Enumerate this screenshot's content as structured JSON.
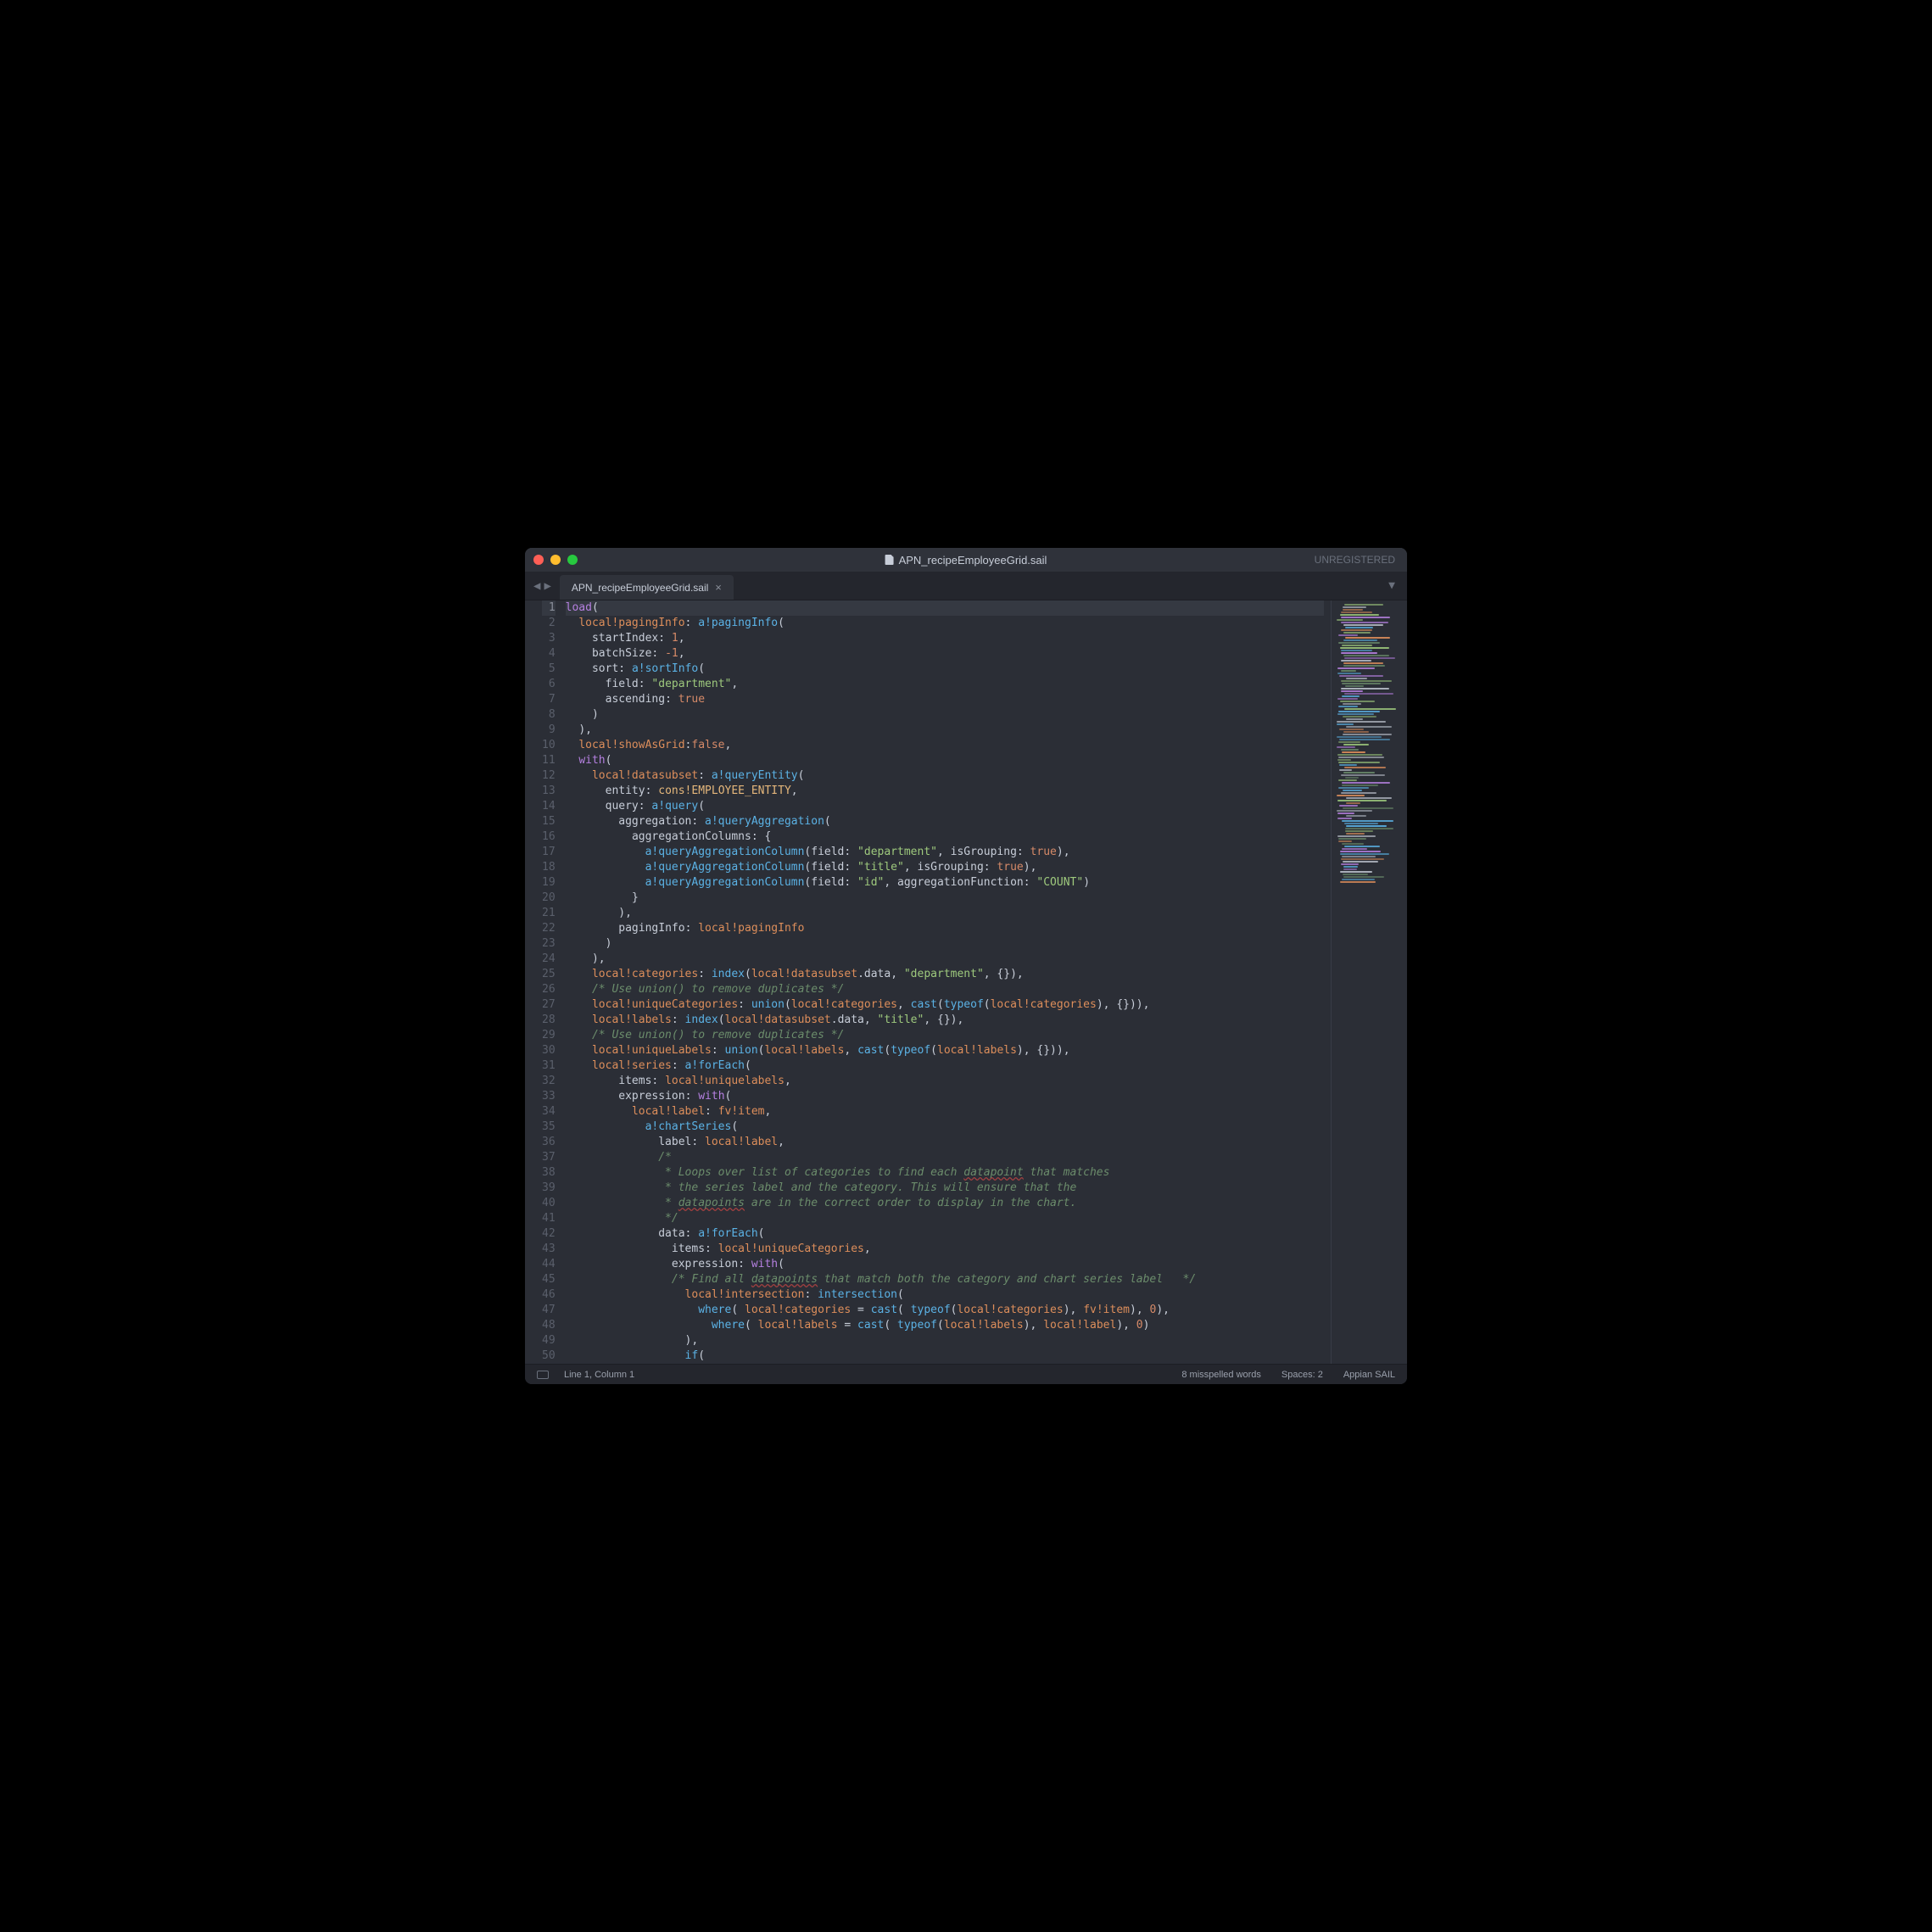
{
  "window": {
    "title": "APN_recipeEmployeeGrid.sail",
    "unregistered": "UNREGISTERED"
  },
  "tab": {
    "label": "APN_recipeEmployeeGrid.sail",
    "close": "×"
  },
  "statusbar": {
    "position": "Line 1, Column 1",
    "spell": "8 misspelled words",
    "spaces": "Spaces: 2",
    "syntax": "Appian SAIL"
  },
  "arrows": {
    "left": "◀",
    "right": "▶",
    "menu": "▼"
  },
  "lines": [
    1,
    2,
    3,
    4,
    5,
    6,
    7,
    8,
    9,
    10,
    11,
    12,
    13,
    14,
    15,
    16,
    17,
    18,
    19,
    20,
    21,
    22,
    23,
    24,
    25,
    26,
    27,
    28,
    29,
    30,
    31,
    32,
    33,
    34,
    35,
    36,
    37,
    38,
    39,
    40,
    41,
    42,
    43,
    44,
    45,
    46,
    47,
    48,
    49,
    50
  ],
  "code": {
    "indent": "  ",
    "kw_load": "load",
    "kw_with": "with",
    "lparen": "(",
    "rparen": ")",
    "lbrace": "{",
    "rbrace": "}",
    "comma": ",",
    "colon": ":",
    "dot": ".",
    "eq": "=",
    "local_pagingInfo": "local!pagingInfo",
    "local_showAsGrid": "local!showAsGrid",
    "local_datasubset": "local!datasubset",
    "local_categories": "local!categories",
    "local_uniqueCategories": "local!uniqueCategories",
    "local_labels": "local!labels",
    "local_uniqueLabels": "local!uniqueLabels",
    "local_uniquelabels_lc": "local!uniquelabels",
    "local_series": "local!series",
    "local_label": "local!label",
    "local_intersection": "local!intersection",
    "fv_item": "fv!item",
    "a_pagingInfo": "a!pagingInfo",
    "a_sortInfo": "a!sortInfo",
    "a_queryEntity": "a!queryEntity",
    "a_query": "a!query",
    "a_queryAggregation": "a!queryAggregation",
    "a_queryAggregationColumn": "a!queryAggregationColumn",
    "a_forEach": "a!forEach",
    "a_chartSeries": "a!chartSeries",
    "p_startIndex": "startIndex",
    "p_batchSize": "batchSize",
    "p_sort": "sort",
    "p_field": "field",
    "p_ascending": "ascending",
    "p_entity": "entity",
    "p_query": "query",
    "p_aggregation": "aggregation",
    "p_aggregationColumns": "aggregationColumns",
    "p_isGrouping": "isGrouping",
    "p_aggregationFunction": "aggregationFunction",
    "p_pagingInfo": "pagingInfo",
    "p_items": "items",
    "p_expression": "expression",
    "p_label": "label",
    "p_data": "data",
    "f_index": "index",
    "f_union": "union",
    "f_cast": "cast",
    "f_typeof": "typeof",
    "f_where": "where",
    "f_intersection": "intersection",
    "f_if": "if",
    "m_data": "data",
    "s_department": "\"department\"",
    "s_title": "\"title\"",
    "s_id": "\"id\"",
    "s_COUNT": "\"COUNT\"",
    "n_1": "1",
    "n_neg1": "-1",
    "n_0": "0",
    "b_true": "true",
    "b_false": "false",
    "c_employee_entity": "cons!EMPLOYEE_ENTITY",
    "cmt_union": "/* Use union() to remove duplicates */",
    "cmt_open": "/*",
    "cmt_l1": " * Loops over list of categories to find each ",
    "cmt_l1b": "datapoint",
    "cmt_l1c": " that matches",
    "cmt_l2": " * the series label and the category. This will ensure that the",
    "cmt_l3": " * ",
    "cmt_l3b": "datapoints",
    "cmt_l3c": " are in the correct order to display in the chart.",
    "cmt_close": " */",
    "cmt_find_a": "/* Find all ",
    "cmt_find_b": "datapoints",
    "cmt_find_c": " that match both the category and chart series label   */"
  }
}
